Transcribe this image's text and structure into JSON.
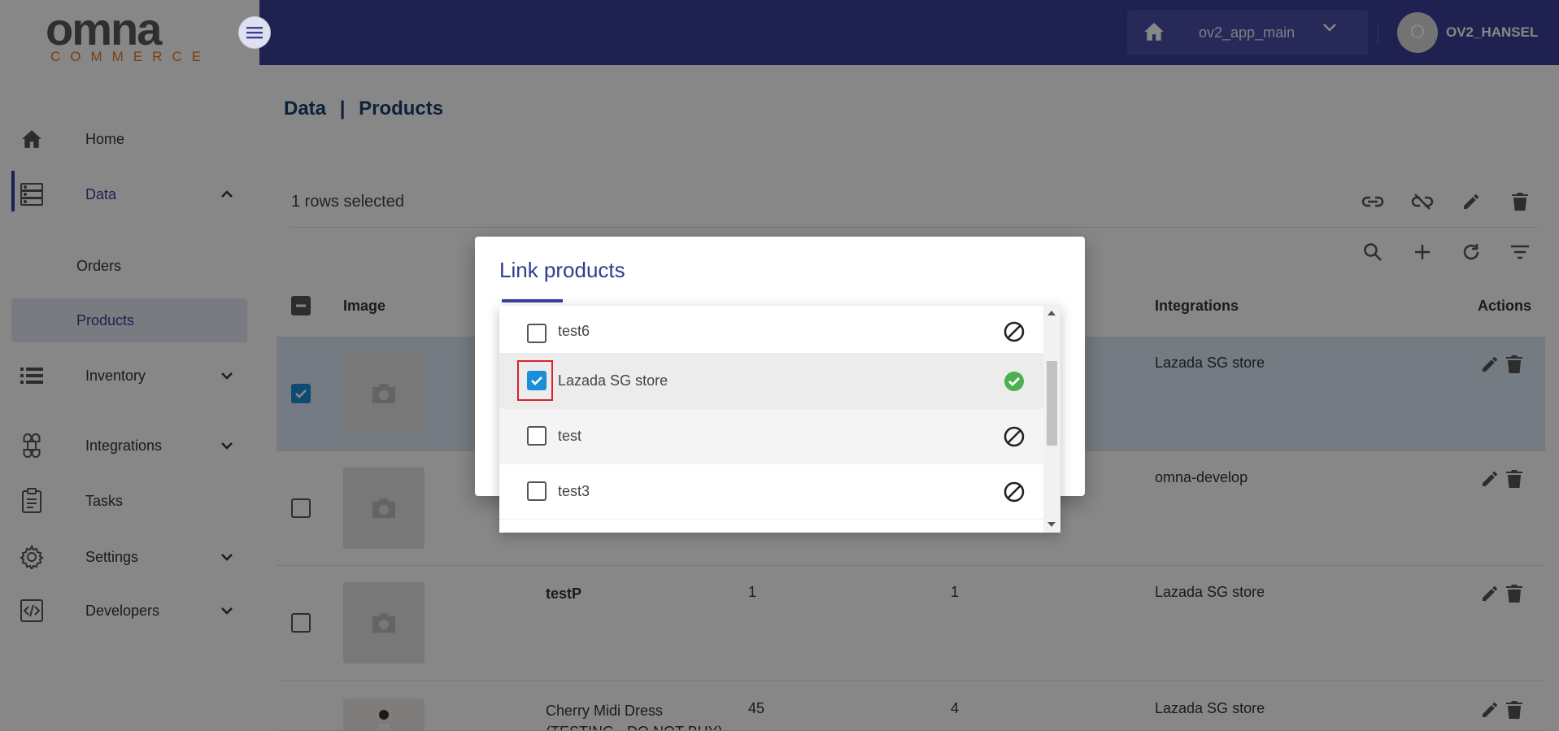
{
  "brand": {
    "logo_main": "omna",
    "logo_sub": "COMMERCE"
  },
  "header": {
    "app_name": "ov2_app_main",
    "avatar_letter": "O",
    "user_name": "OV2_HANSEL"
  },
  "sidebar": {
    "items": [
      {
        "label": "Home",
        "icon": "home-icon"
      },
      {
        "label": "Data",
        "icon": "database-icon",
        "expanded": true
      },
      {
        "label": "Orders"
      },
      {
        "label": "Products",
        "selected": true
      },
      {
        "label": "Inventory",
        "icon": "list-icon"
      },
      {
        "label": "Integrations",
        "icon": "command-icon"
      },
      {
        "label": "Tasks",
        "icon": "clipboard-icon"
      },
      {
        "label": "Settings",
        "icon": "gear-icon"
      },
      {
        "label": "Developers",
        "icon": "code-icon"
      }
    ]
  },
  "page": {
    "breadcrumb_root": "Data",
    "breadcrumb_sep": "|",
    "breadcrumb_current": "Products"
  },
  "toolbar": {
    "selection_text": "1 rows selected"
  },
  "table": {
    "headers": {
      "image": "Image",
      "integrations": "Integrations",
      "actions": "Actions"
    },
    "rows": [
      {
        "name": "",
        "col3": "",
        "col4": "",
        "integration": "Lazada SG store",
        "selected": true
      },
      {
        "name": "",
        "col3": "",
        "col4": "",
        "integration": "omna-develop",
        "selected": false
      },
      {
        "name": "testP",
        "col3": "1",
        "col4": "1",
        "integration": "Lazada SG store",
        "selected": false
      },
      {
        "name": "Cherry Midi Dress (TESTING - DO NOT BUY)",
        "col3": "45",
        "col4": "4",
        "integration": "Lazada SG store",
        "selected": false
      }
    ]
  },
  "modal": {
    "title": "Link products",
    "options": [
      {
        "label": "test6",
        "checked": false,
        "status": "blocked-icon"
      },
      {
        "label": "Lazada SG store",
        "checked": true,
        "status": "check-circle-icon"
      },
      {
        "label": "test",
        "checked": false,
        "status": "blocked-icon"
      },
      {
        "label": "test3",
        "checked": false,
        "status": "blocked-icon"
      }
    ]
  },
  "colors": {
    "primary": "#3b3f99",
    "accent": "#e07b28",
    "check": "#1a8fd8",
    "success": "#4caf50",
    "highlight": "#d9232d"
  }
}
